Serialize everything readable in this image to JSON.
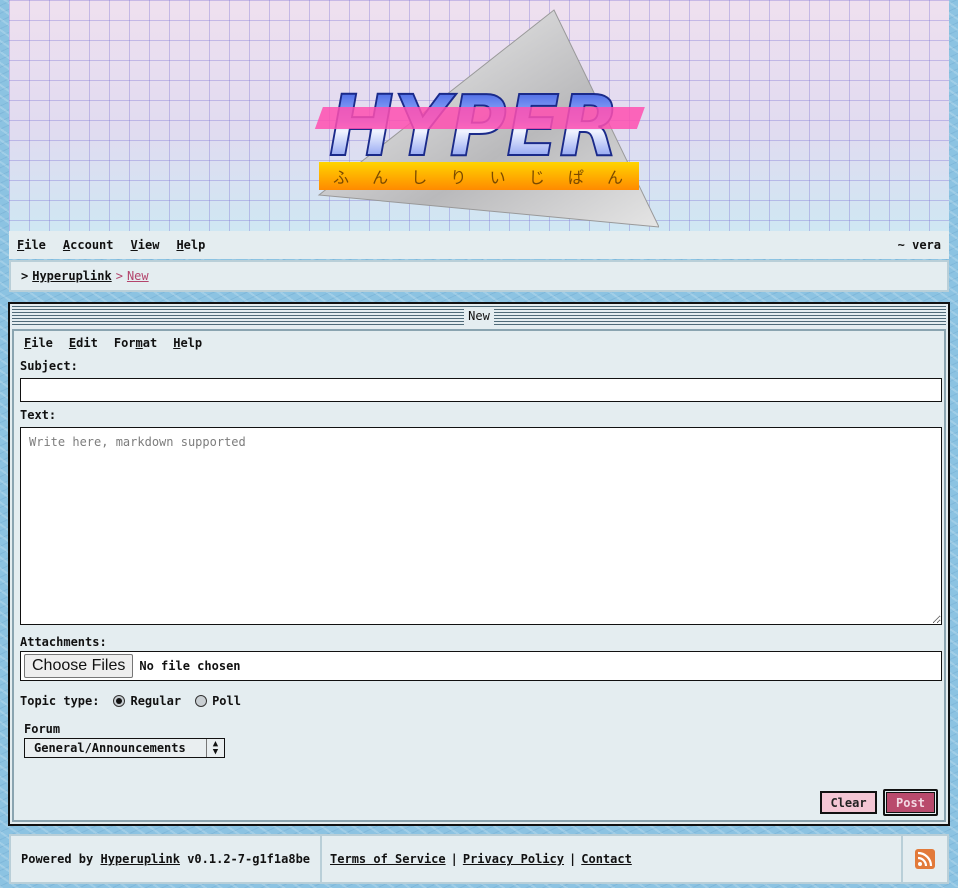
{
  "header": {
    "logo_text": "HYPER",
    "logo_subtext": "ふんしりいじぱん"
  },
  "menubar": {
    "items": [
      {
        "label": "File",
        "accel": "F",
        "rest": "ile"
      },
      {
        "label": "Account",
        "accel": "A",
        "rest": "ccount"
      },
      {
        "label": "View",
        "accel": "V",
        "rest": "iew"
      },
      {
        "label": "Help",
        "accel": "H",
        "rest": "elp"
      }
    ],
    "user": "~ vera"
  },
  "breadcrumb": {
    "prefix": ">",
    "root": "Hyperuplink",
    "separator": ">",
    "current": "New"
  },
  "window": {
    "title": "New",
    "menu": [
      {
        "label": "File",
        "before": "",
        "accel": "F",
        "after": "ile"
      },
      {
        "label": "Edit",
        "before": "",
        "accel": "E",
        "after": "dit"
      },
      {
        "label": "Format",
        "before": "For",
        "accel": "m",
        "after": "at"
      },
      {
        "label": "Help",
        "before": "",
        "accel": "H",
        "after": "elp"
      }
    ],
    "form": {
      "subject_label": "Subject:",
      "subject_value": "",
      "text_label": "Text:",
      "text_placeholder": "Write here, markdown supported",
      "attachments_label": "Attachments:",
      "choose_files_label": "Choose Files",
      "no_file_label": "No file chosen",
      "topic_type_label": "Topic type:",
      "topic_options": [
        {
          "label": "Regular",
          "checked": true
        },
        {
          "label": "Poll",
          "checked": false
        }
      ],
      "forum_label": "Forum",
      "forum_selected": "General/Announcements",
      "clear_label": "Clear",
      "post_label": "Post"
    }
  },
  "footer": {
    "powered_prefix": "Powered by",
    "powered_link": "Hyperuplink",
    "version": "v0.1.2-7-g1f1a8be",
    "links": [
      "Terms of Service",
      "Privacy Policy",
      "Contact"
    ],
    "separator": "|"
  },
  "colors": {
    "accent": "#b94a6c",
    "clear_button": "#f4c6d4",
    "panel": "#e4edf0",
    "rss": "#e27a3a"
  }
}
